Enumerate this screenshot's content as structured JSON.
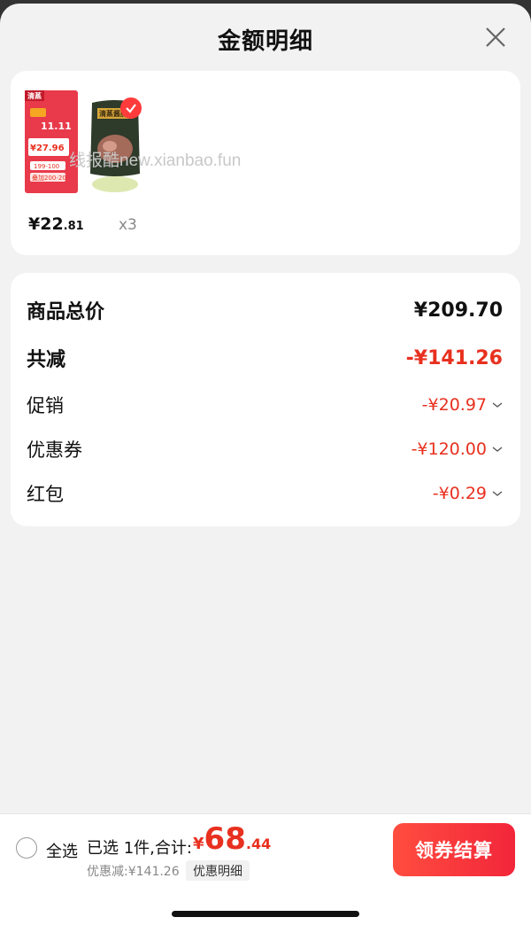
{
  "header": {
    "title": "金额明细"
  },
  "product": {
    "price_main": "¥22",
    "price_decimal": ".81",
    "quantity": "x3",
    "watermark": "线报酷new.xianbao.fun",
    "thumb1_texts": {
      "brand": "清蒸",
      "promo": "11.11",
      "price": "¥27.96",
      "line1": "199-100",
      "line2": "叠加200-20"
    },
    "thumb2_texts": {
      "brand": "清蒸酱肘"
    }
  },
  "breakdown": {
    "total_label": "商品总价",
    "total_value": "¥209.70",
    "reduce_label": "共减",
    "reduce_value": "-¥141.26",
    "items": [
      {
        "label": "促销",
        "value": "-¥20.97"
      },
      {
        "label": "优惠券",
        "value": "-¥120.00"
      },
      {
        "label": "红包",
        "value": "-¥0.29"
      }
    ]
  },
  "footer": {
    "select_all": "全选",
    "selected_text": "已选 1件,合计:",
    "currency": "¥",
    "amount_int": "68",
    "amount_dec": ".44",
    "discount_text": "优惠减:¥141.26",
    "detail_tag": "优惠明细",
    "checkout_label": "领券结算"
  },
  "colors": {
    "accent": "#e8301f",
    "button": "#f2263a"
  }
}
